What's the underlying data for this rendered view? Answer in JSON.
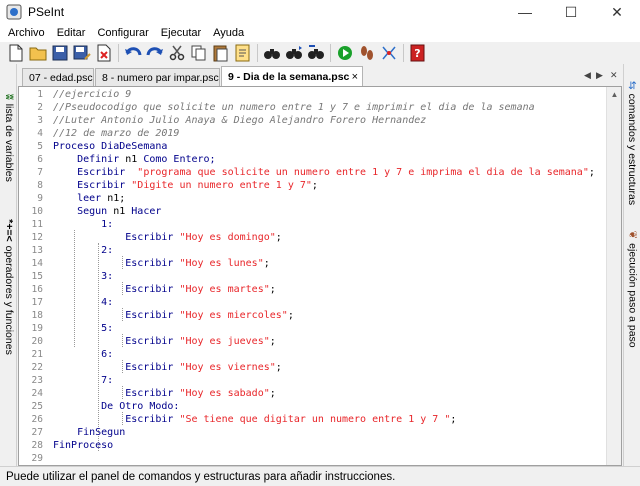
{
  "window": {
    "title": "PSeInt",
    "minimize": "—",
    "maximize": "☐",
    "close": "✕"
  },
  "menu": [
    "Archivo",
    "Editar",
    "Configurar",
    "Ejecutar",
    "Ayuda"
  ],
  "toolbar_icons": [
    "new-file",
    "open-folder",
    "save",
    "save-as",
    "close",
    "undo",
    "redo",
    "cut",
    "copy",
    "paste",
    "comment",
    "find",
    "find-next",
    "replace",
    "run",
    "step",
    "debug",
    "help"
  ],
  "left_panel": {
    "variables_label": "lista de variables",
    "variables_glyph": "*+=<",
    "operators_label": "operadores y funciones"
  },
  "right_panel": {
    "commands_label": "comandos y estructuras",
    "step_label": "ejecución paso a paso"
  },
  "tabs": [
    {
      "label": "07 - edad.psc",
      "close": ""
    },
    {
      "label": "8 - numero par impar.psc",
      "close": ""
    },
    {
      "label": "9 - Dia de la semana.psc",
      "close": "×"
    }
  ],
  "tab_nav": {
    "prev": "◀",
    "next": "▶",
    "close": "✕"
  },
  "code": [
    {
      "n": "1",
      "segments": [
        {
          "t": "//ejercicio 9",
          "c": "cmt"
        }
      ]
    },
    {
      "n": "2",
      "segments": [
        {
          "t": "//Pseudocodigo que solicite un numero entre 1 y 7 e imprimir el dia de la semana",
          "c": "cmt"
        }
      ]
    },
    {
      "n": "3",
      "segments": [
        {
          "t": "//Luter Antonio Julio Anaya & Diego Alejandro Forero Hernandez",
          "c": "cmt"
        }
      ]
    },
    {
      "n": "4",
      "segments": [
        {
          "t": "//12 de marzo de 2019",
          "c": "cmt"
        }
      ]
    },
    {
      "n": "5",
      "segments": [
        {
          "t": "Proceso ",
          "c": "kw"
        },
        {
          "t": "DiaDeSemana",
          "c": "kw"
        }
      ]
    },
    {
      "n": "6",
      "segments": [
        {
          "t": "    Definir ",
          "c": "kw"
        },
        {
          "t": "n1",
          "c": "idt"
        },
        {
          "t": " Como Entero;",
          "c": "kw"
        }
      ]
    },
    {
      "n": "7",
      "segments": [
        {
          "t": "    Escribir  ",
          "c": "kw"
        },
        {
          "t": "\"programa que solicite un numero entre 1 y 7 e imprima el dia de la semana\"",
          "c": "str"
        },
        {
          "t": ";",
          "c": "idt"
        }
      ]
    },
    {
      "n": "8",
      "segments": [
        {
          "t": "    Escribir ",
          "c": "kw"
        },
        {
          "t": "\"Digite un numero entre 1 y 7\"",
          "c": "str"
        },
        {
          "t": ";",
          "c": "idt"
        }
      ]
    },
    {
      "n": "9",
      "segments": [
        {
          "t": "    leer ",
          "c": "kw"
        },
        {
          "t": "n1;",
          "c": "idt"
        }
      ]
    },
    {
      "n": "10",
      "segments": [
        {
          "t": "    Segun ",
          "c": "kw"
        },
        {
          "t": "n1",
          "c": "idt"
        },
        {
          "t": " Hacer",
          "c": "kw"
        }
      ]
    },
    {
      "n": "11",
      "segments": [
        {
          "t": "        1:",
          "c": "case"
        }
      ]
    },
    {
      "n": "12",
      "segments": [
        {
          "t": "            Escribir ",
          "c": "kw"
        },
        {
          "t": "\"Hoy es domingo\"",
          "c": "str"
        },
        {
          "t": ";",
          "c": "idt"
        }
      ]
    },
    {
      "n": "13",
      "segments": [
        {
          "t": "        2:",
          "c": "case"
        }
      ]
    },
    {
      "n": "14",
      "segments": [
        {
          "t": "            Escribir ",
          "c": "kw"
        },
        {
          "t": "\"Hoy es lunes\"",
          "c": "str"
        },
        {
          "t": ";",
          "c": "idt"
        }
      ]
    },
    {
      "n": "15",
      "segments": [
        {
          "t": "        3:",
          "c": "case"
        }
      ]
    },
    {
      "n": "16",
      "segments": [
        {
          "t": "            Escribir ",
          "c": "kw"
        },
        {
          "t": "\"Hoy es martes\"",
          "c": "str"
        },
        {
          "t": ";",
          "c": "idt"
        }
      ]
    },
    {
      "n": "17",
      "segments": [
        {
          "t": "        4:",
          "c": "case"
        }
      ]
    },
    {
      "n": "18",
      "segments": [
        {
          "t": "            Escribir ",
          "c": "kw"
        },
        {
          "t": "\"Hoy es miercoles\"",
          "c": "str"
        },
        {
          "t": ";",
          "c": "idt"
        }
      ]
    },
    {
      "n": "19",
      "segments": [
        {
          "t": "        5:",
          "c": "case"
        }
      ]
    },
    {
      "n": "20",
      "segments": [
        {
          "t": "            Escribir ",
          "c": "kw"
        },
        {
          "t": "\"Hoy es jueves\"",
          "c": "str"
        },
        {
          "t": ";",
          "c": "idt"
        }
      ]
    },
    {
      "n": "21",
      "segments": [
        {
          "t": "        6:",
          "c": "case"
        }
      ]
    },
    {
      "n": "22",
      "segments": [
        {
          "t": "            Escribir ",
          "c": "kw"
        },
        {
          "t": "\"Hoy es viernes\"",
          "c": "str"
        },
        {
          "t": ";",
          "c": "idt"
        }
      ]
    },
    {
      "n": "23",
      "segments": [
        {
          "t": "        7:",
          "c": "case"
        }
      ]
    },
    {
      "n": "24",
      "segments": [
        {
          "t": "            Escribir ",
          "c": "kw"
        },
        {
          "t": "\"Hoy es sabado\"",
          "c": "str"
        },
        {
          "t": ";",
          "c": "idt"
        }
      ]
    },
    {
      "n": "25",
      "segments": [
        {
          "t": "        De Otro Modo:",
          "c": "kw"
        }
      ]
    },
    {
      "n": "26",
      "segments": [
        {
          "t": "            Escribir ",
          "c": "kw"
        },
        {
          "t": "\"Se tiene que digitar un numero entre 1 y 7 \"",
          "c": "str"
        },
        {
          "t": ";",
          "c": "idt"
        }
      ]
    },
    {
      "n": "27",
      "segments": [
        {
          "t": "    FinSegun",
          "c": "kw"
        }
      ]
    },
    {
      "n": "28",
      "segments": [
        {
          "t": "FinProceso",
          "c": "kw"
        }
      ]
    },
    {
      "n": "29",
      "segments": []
    }
  ],
  "status": "Puede utilizar el panel de comandos y estructuras para añadir instrucciones.",
  "colors": {
    "keyword": "#00008b",
    "string": "#e8262a",
    "comment": "#777777"
  }
}
